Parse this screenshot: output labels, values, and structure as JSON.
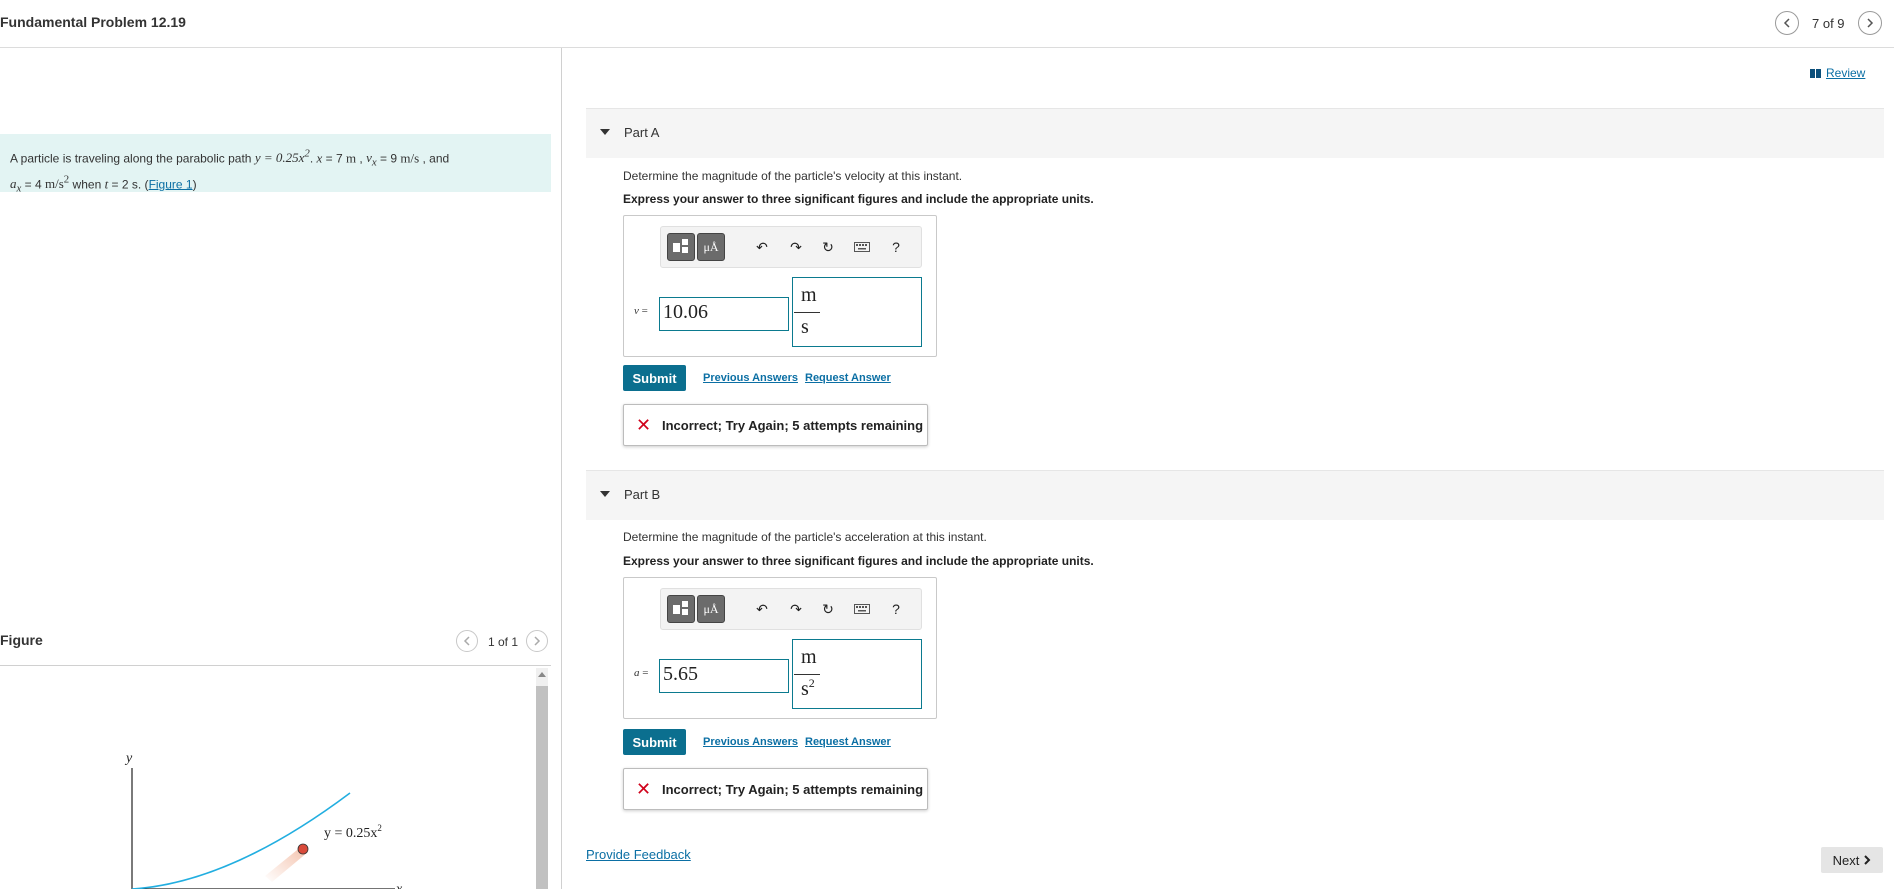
{
  "header": {
    "title": "Fundamental Problem 12.19",
    "counter": "7 of 9"
  },
  "problem": {
    "intro": "A particle is traveling along the parabolic path ",
    "eq_path": "y = 0.25x",
    "eq_path_sup": "2",
    "sep1": ". ",
    "x_lhs": "x",
    "x_val": " = 7 ",
    "x_unit": "m",
    "sep2": " , ",
    "vx_lhs": "v",
    "vx_sub": "x",
    "vx_val": " = 9 ",
    "vx_unit": "m/s",
    "sep3": " , and",
    "ax_lhs": "a",
    "ax_sub": "x",
    "ax_val": " = 4 ",
    "ax_unit": "m/s",
    "ax_unit_sup": "2",
    "when": " when ",
    "t_lhs": "t",
    "t_val": " = 2 s. (",
    "figure_link": "Figure 1",
    "close": ")"
  },
  "figure": {
    "title": "Figure",
    "counter": "1 of 1",
    "axis_y": "y",
    "axis_x": "x",
    "curve_label": "y = 0.25x",
    "curve_label_sup": "2"
  },
  "review": {
    "label": "Review"
  },
  "partA": {
    "label": "Part A",
    "question": "Determine the magnitude of the particle's velocity at this instant.",
    "instruction": "Express your answer to three significant figures and include the appropriate units.",
    "var": "v",
    "eq": " =",
    "value": "10.06",
    "unit_num": "m",
    "unit_den": "s",
    "unit_den_sup": "",
    "submit": "Submit",
    "previous": "Previous Answers",
    "request": "Request Answer",
    "feedback": "Incorrect; Try Again; 5 attempts remaining"
  },
  "partB": {
    "label": "Part B",
    "question": "Determine the magnitude of the particle's acceleration at this instant.",
    "instruction": "Express your answer to three significant figures and include the appropriate units.",
    "var": "a",
    "eq": " =",
    "value": "5.65",
    "unit_num": "m",
    "unit_den": "s",
    "unit_den_sup": "2",
    "submit": "Submit",
    "previous": "Previous Answers",
    "request": "Request Answer",
    "feedback": "Incorrect; Try Again; 5 attempts remaining"
  },
  "toolbar": {
    "units_label": "μÅ",
    "help": "?"
  },
  "footer": {
    "provide_feedback": "Provide Feedback",
    "next": "Next"
  },
  "colors": {
    "accent": "#0b6f8f",
    "link": "#0b6fa4",
    "problem_bg": "#e3f4f3",
    "error": "#d0021b"
  }
}
